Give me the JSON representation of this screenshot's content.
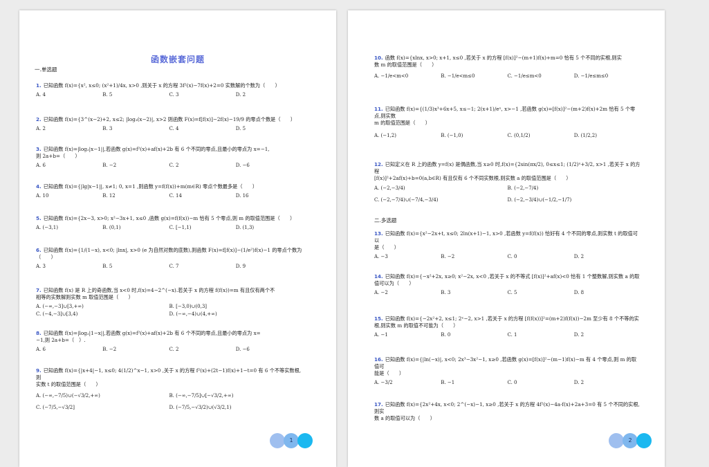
{
  "page1": {
    "title": "函数嵌套问题",
    "section1": "一.单选题",
    "page_number": "1",
    "questions": [
      {
        "num": "1.",
        "stem": "已知函数 f(x)={x², x≤0; (x²+1)/4x, x>0 ,则关于 x 的方程 3f²(x)−7f(x)+2=0 实数解的个数为（　　）",
        "opts": [
          "A. 4",
          "B. 5",
          "C. 3",
          "D. 2"
        ]
      },
      {
        "num": "2.",
        "stem": "已知函数 f(x)={3^(x−2)+2, x≤2; |log₃(x−2)|, x>2 则函数 F(x)=f[f(x)]−2f(x)−19/9 的零点个数是（　　）",
        "opts": [
          "A. 2",
          "B. 3",
          "C. 4",
          "D. 5"
        ]
      },
      {
        "num": "3.",
        "stem": "已知函数 f(x)=|log₂|x−1||,若函数 g(x)=f²(x)+af(x)+2b 有 6 个不同的零点,且最小的零点为 x=−1,\n则 2a+b=（　　）",
        "opts": [
          "A. 6",
          "B. −2",
          "C. 2",
          "D. −6"
        ]
      },
      {
        "num": "4.",
        "stem": "已知函数 f(x)={|lg|x−1||, x≠1; 0, x=1 ,则函数 y=f(f(x))+m(m∈R) 零点个数最多是（　　）",
        "opts": [
          "A. 10",
          "B. 12",
          "C. 14",
          "D. 16"
        ]
      },
      {
        "num": "5.",
        "stem": "已知函数 f(x)={2x−3, x>0; x²−3x+1, x≤0 ,函数 g(x)=f(f(x))−m 恰有 5 个零点,则 m 的取值范围是（　　）",
        "opts": [
          "A. (−3,1)",
          "B. (0,1)",
          "C. [−1,1)",
          "D. (1,3)"
        ]
      },
      {
        "num": "6.",
        "stem": "已知函数 f(x)={1/(1−x), x<0; |lnx|, x>0 (e 为自然对数的底数),则函数 F(x)=f[f(x)]−(1/e²)f(x)−1 的零点个数为\n（　　）",
        "opts": [
          "A. 3",
          "B. 5",
          "C. 7",
          "D. 9"
        ]
      },
      {
        "num": "7.",
        "stem": "已知函数 f(x) 是 R 上的奇函数,当 x<0 时,f(x)=4−2^(−x).若关于 x 的方程 f(f(x))=m 有且仅有两个不\n相等的实数解则实数 m 取值范围是（　　）",
        "opts2": [
          "A. (−∞,−3]∪[3,+∞)",
          "B. [−3,0)∪(0,3]",
          "C. (−4,−3]∪[3,4)",
          "D. (−∞,−4)∪(4,+∞)"
        ]
      },
      {
        "num": "8.",
        "stem": "已知函数 f(x)=|log₂|1−x||,若函数 g(x)=f²(x)+af(x)+2b 有 6 个不同的零点,且最小的零点为 x=\n−1,则 2a+b=（　）.",
        "opts": [
          "A. 6",
          "B. −2",
          "C. 2",
          "D. −6"
        ]
      },
      {
        "num": "9.",
        "stem": "已知函数 f(x)={|x+4|−1, x≤0; 4(1/2)^x−1, x>0 ,关于 x 的方程 f²(x)+(2t−1)f(x)+1−t=0 有 6 个不等实数根,则\n实数 t 的取值范围是（　　）",
        "opts2": [
          "A. (−∞,−7/5)∪(−√3/2,+∞)",
          "B. (−∞,−7/5]∪[−√3/2,+∞)",
          "C. (−7/5,−√3/2]",
          "D. (−7/5,−√3/2)∪(√3/2,1)"
        ]
      }
    ]
  },
  "page2": {
    "section2": "二.多选题",
    "page_number": "2",
    "questions": [
      {
        "num": "10.",
        "stem": "函数 f(x)={xlnx, x>0; x+1, x≤0 ,若关于 x 的方程 [f(x)]²−(m+1)f(x)+m=0 恰有 5 个不同的实根,则实\n数 m 的取值范围是（　　）",
        "opts": [
          "A. −1/e<m<0",
          "B. −1/e<m≤0",
          "C. −1/e≤m<0",
          "D. −1/e≤m≤0"
        ]
      },
      {
        "num": "11.",
        "stem": "已知函数 f(x)={(1/3)x³+6x+5, x≤−1; 2(x+1)/eˣ, x>−1 ,若函数 g(x)=[f(x)]²−(m+2)f(x)+2m 恰有 5 个零点,则实数\nm 的取值范围是（　　）",
        "opts": [
          "A. (−1,2)",
          "B. (−1,0)",
          "C. (0,1/2)",
          "D. (1/2,2)"
        ]
      },
      {
        "num": "12.",
        "stem": "已知定义在 R 上的函数 y=f(x) 是偶函数,当 x≥0 时,f(x)={2sin(πx/2), 0≤x≤1; (1/2)ˣ+3/2, x>1 ,若关于 x 的方程\n[f(x)]²+2af(x)+b=0(a,b∈R) 有且仅有 6 个不同实数根,则实数 a 的取值范围是（　　）",
        "opts2": [
          "A. (−2,−3/4)",
          "B. (−2,−7/4)",
          "C. (−2,−7/4)∪(−7/4,−3/4)",
          "D. (−2,−3/4)∪(−1/2,−1/7)"
        ]
      },
      {
        "num": "13.",
        "stem": "已知函数 f(x)={x²−2x+t, x≤0; 2ln(x+1)−1, x>0 ,若函数 y=f(f(x)) 恰好有 4 个不同的零点,则实数 t 的取值可以\n是（　　）",
        "opts": [
          "A. −3",
          "B. −2",
          "C. 0",
          "D. 2"
        ]
      },
      {
        "num": "14.",
        "stem": "已知函数 f(x)={−x²+2x, x≥0; x²−2x, x<0 ,若关于 x 的不等式 [f(x)]²+af(x)<0 恰有 1 个整数解,则实数 a 的取\n值可以为（　　）",
        "opts": [
          "A. −2",
          "B. 3",
          "C. 5",
          "D. 8"
        ]
      },
      {
        "num": "15.",
        "stem": "已知函数 f(x)={−2x²+2, x≤1; 2ˣ−2, x>1 ,若关于 x 的方程 [f(f(x))]²=(m+2)f(f(x))−2m 至少有 8 个不等的实\n根,则实数 m 的取值不可能为（　　）",
        "opts": [
          "A. −1",
          "B. 0",
          "C. 1",
          "D. 2"
        ]
      },
      {
        "num": "16.",
        "stem": "已知函数 f(x)={|ln(−x)|, x<0; 2x³−3x²−1, x≥0 ,若函数 g(x)=[f(x)]²−(m−1)f(x)−m 有 4 个零点,则 m 的取值可\n能是（　　）",
        "opts": [
          "A. −3/2",
          "B. −1",
          "C. 0",
          "D. 2"
        ]
      },
      {
        "num": "17.",
        "stem": "已知函数 f(x)={2x²+4x, x<0; 2^(−x)−1, x≥0 ,若关于 x 的方程 4f²(x)−4a·f(x)+2a+3=0 有 5 个不同的实根,则实\n数 a 的取值可以为（　　）",
        "opts": []
      }
    ]
  }
}
